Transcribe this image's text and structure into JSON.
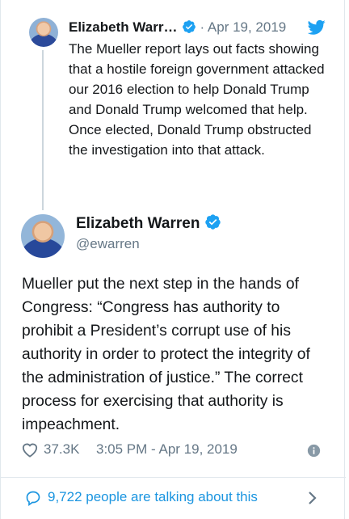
{
  "parent_tweet": {
    "name": "Elizabeth Warr…",
    "date": "· Apr 19, 2019",
    "text": "The Mueller report lays out facts showing that a hostile foreign government attacked our 2016 election to help Donald Trump and Donald Trump welcomed that help. Once elected, Donald Trump obstructed the investigation into that attack."
  },
  "main_tweet": {
    "name": "Elizabeth Warren",
    "handle": "@ewarren",
    "text": "Mueller put the next step in the hands of Congress: “Congress has authority to prohibit a President’s corrupt use of his authority in order to protect the integrity of the administration of justice.” The correct process for exercising that authority is impeachment.",
    "likes": "37.3K",
    "timestamp": "3:05 PM - Apr 19, 2019"
  },
  "footer": {
    "talking": "9,722 people are talking about this"
  },
  "colors": {
    "twitter_blue": "#1da1f2",
    "link_blue": "#1b95e0",
    "secondary_text": "#657786"
  },
  "icons": [
    "verified-badge-icon",
    "twitter-bird-icon",
    "heart-icon",
    "info-icon",
    "speech-bubble-icon",
    "chevron-right-icon"
  ]
}
